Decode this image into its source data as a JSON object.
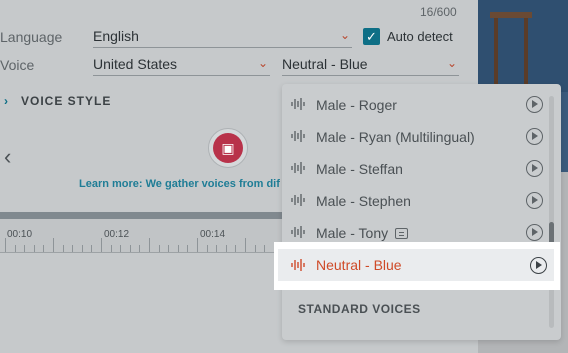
{
  "counter": "16/600",
  "language": {
    "label": "Language",
    "value": "English"
  },
  "auto_detect": {
    "label": "Auto detect",
    "checked": true
  },
  "voice": {
    "label": "Voice",
    "region": "United States",
    "selected": "Neutral - Blue"
  },
  "voice_style": "VOICE STYLE",
  "learn_more": "Learn more: We gather voices from dif",
  "timeline": {
    "ticks": [
      "00:10",
      "00:12",
      "00:14"
    ]
  },
  "dropdown": {
    "options": [
      {
        "label": "Male - Roger"
      },
      {
        "label": "Male - Ryan (Multilingual)"
      },
      {
        "label": "Male - Steffan"
      },
      {
        "label": "Male - Stephen"
      },
      {
        "label": "Male - Tony",
        "badge": true
      },
      {
        "label": "Neutral - Blue",
        "selected": true
      }
    ],
    "section": "STANDARD VOICES"
  },
  "colors": {
    "accent": "#0e6f86",
    "selected": "#cf4a28",
    "robot": "#b8324a"
  }
}
